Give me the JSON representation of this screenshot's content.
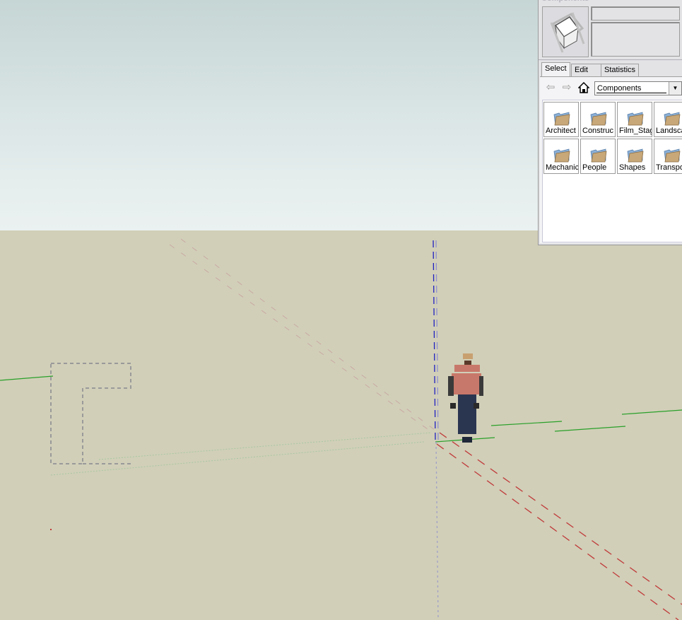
{
  "panel": {
    "title": "Components",
    "name_field": "",
    "description_field": "",
    "tabs": [
      {
        "label": "Select",
        "active": true
      },
      {
        "label": "Edit",
        "active": false
      },
      {
        "label": "Statistics",
        "active": false
      }
    ],
    "nav": {
      "back_icon": "arrow-left-icon",
      "forward_icon": "arrow-right-icon",
      "home_icon": "home-icon"
    },
    "collection": {
      "selected": "Components"
    },
    "items": [
      {
        "label": "Architect",
        "icon": "folder-icon"
      },
      {
        "label": "Construc",
        "icon": "folder-icon"
      },
      {
        "label": "Film_Stag",
        "icon": "folder-icon"
      },
      {
        "label": "Landsca",
        "icon": "folder-icon"
      },
      {
        "label": "Mechanic",
        "icon": "folder-icon"
      },
      {
        "label": "People",
        "icon": "folder-icon"
      },
      {
        "label": "Shapes",
        "icon": "folder-icon"
      },
      {
        "label": "Transpo",
        "icon": "folder-icon"
      }
    ]
  },
  "scene": {
    "colors": {
      "sky_top": "#c6d6d5",
      "sky_bottom": "#ebf1f1",
      "ground": "#d1cfb8",
      "red_axis": "#c03a3a",
      "green_axis": "#2aa02a",
      "blue_axis": "#2020c0",
      "guide": "#9a9a9a",
      "shirt": "#c8786a",
      "pants": "#2a3550"
    },
    "objects": [
      "axes",
      "person-figure",
      "dashed-l-shape-outline",
      "guide-lines"
    ]
  }
}
